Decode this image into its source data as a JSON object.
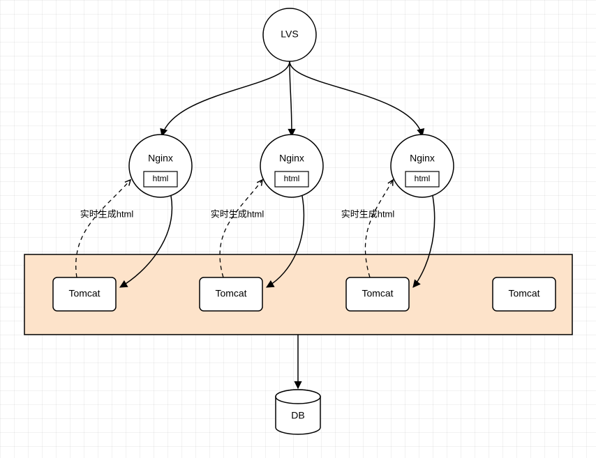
{
  "diagram": {
    "lvs": {
      "label": "LVS"
    },
    "nginx": [
      {
        "label": "Nginx",
        "sublabel": "html",
        "annotation": "实时生成html"
      },
      {
        "label": "Nginx",
        "sublabel": "html",
        "annotation": "实时生成html"
      },
      {
        "label": "Nginx",
        "sublabel": "html",
        "annotation": "实时生成html"
      }
    ],
    "tomcat": [
      {
        "label": "Tomcat"
      },
      {
        "label": "Tomcat"
      },
      {
        "label": "Tomcat"
      },
      {
        "label": "Tomcat"
      }
    ],
    "db": {
      "label": "DB"
    }
  }
}
